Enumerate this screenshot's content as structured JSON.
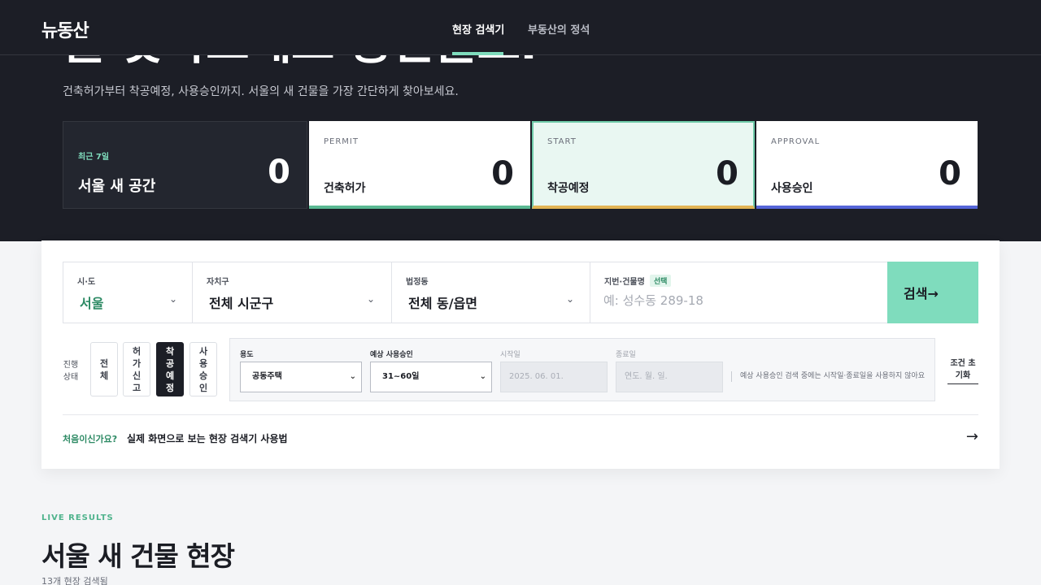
{
  "nav": {
    "logo": "뉴동산",
    "links": [
      "현장 검색기",
      "부동산의 정석"
    ],
    "accent": "#7fdcbd"
  },
  "hero": {
    "headline": "를 찾아보세요 공간을요.",
    "subtitle": "건축허가부터 착공예정, 사용승인까지. 서울의 새 건물을 가장 간단하게 찾아보세요."
  },
  "stats": {
    "summary": {
      "kicker": "최근 7일",
      "title": "서울 새 공간",
      "count": "0"
    },
    "cards": [
      {
        "en": "PERMIT",
        "title": "건축허가",
        "count": "0",
        "color": "#5ab892"
      },
      {
        "en": "START",
        "title": "착공예정",
        "count": "0",
        "color": "#e2b455"
      },
      {
        "en": "APPROVAL",
        "title": "사용승인",
        "count": "0",
        "color": "#5565d8"
      }
    ]
  },
  "search": {
    "sido": {
      "label": "시·도",
      "value": "서울"
    },
    "gu": {
      "label": "자치구",
      "value": "전체 시군구"
    },
    "dong": {
      "label": "법정동",
      "value": "전체 동/읍면"
    },
    "address": {
      "label": "지번·건물명",
      "badge": "선택",
      "placeholder": "예: 성수동 289-18"
    },
    "button": "검색→"
  },
  "status": {
    "label": "진행 상태",
    "options": [
      "전체",
      "허가신고",
      "착공예정",
      "사용승인"
    ],
    "active": "착공예정"
  },
  "filters": {
    "use_label": "용도",
    "use_value": "공동주택",
    "approval_label": "예상 사용승인",
    "approval_value": "31~60일",
    "start_label": "시작일",
    "start_value": "2025. 06. 01.",
    "end_label": "종료일",
    "end_placeholder": "연도. 월. 일.",
    "note": "예상 사용승인 검색 중에는 시작일·종료일을 사용하지 않아요",
    "reset": "조건 초기화"
  },
  "guide": {
    "question": "처음이신가요?",
    "text": "실제 화면으로 보는 현장 검색기 사용법",
    "arrow": "→"
  },
  "results": {
    "kicker": "LIVE RESULTS",
    "title": "서울 새 건물 현장",
    "count": "13개 현장 검색됨"
  }
}
